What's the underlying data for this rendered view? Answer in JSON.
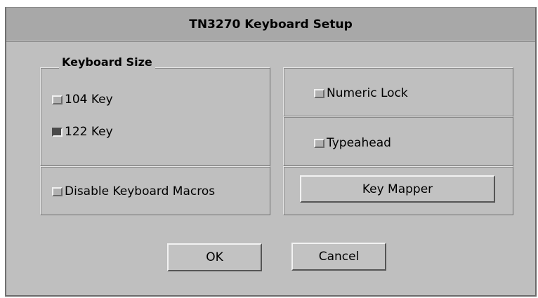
{
  "window": {
    "title": "TN3270 Keyboard Setup"
  },
  "keyboard_size": {
    "label": "Keyboard Size",
    "options": [
      {
        "label": "104 Key",
        "selected": false
      },
      {
        "label": "122 Key",
        "selected": true
      }
    ]
  },
  "disable_macros": {
    "label": "Disable Keyboard Macros",
    "checked": false
  },
  "numeric_lock": {
    "label": "Numeric Lock",
    "checked": false
  },
  "typeahead": {
    "label": "Typeahead",
    "checked": false
  },
  "buttons": {
    "key_mapper": "Key Mapper",
    "ok": "OK",
    "cancel": "Cancel"
  }
}
